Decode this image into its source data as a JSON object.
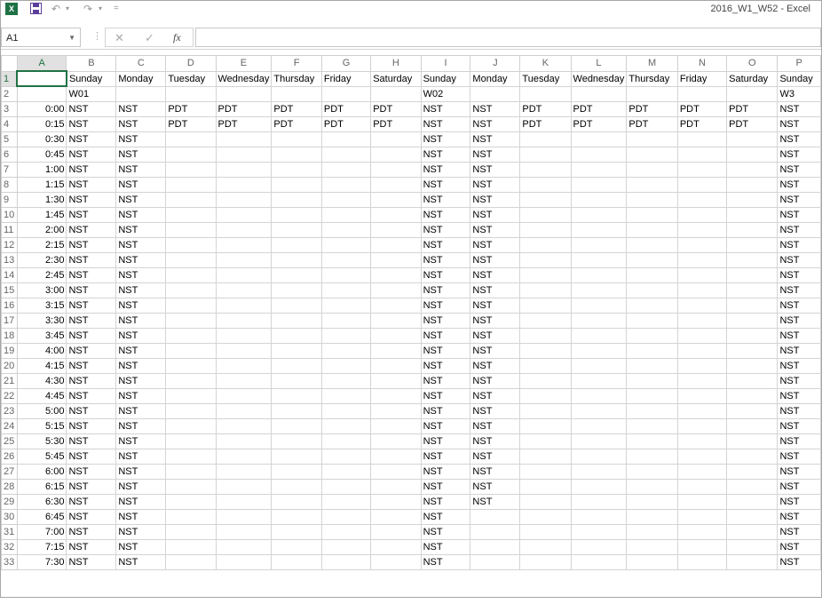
{
  "window": {
    "title": "2016_W1_W52 - Excel"
  },
  "quick_access": {
    "undo": "↶",
    "redo": "↷",
    "customize": "="
  },
  "formula_bar": {
    "name_box": "A1",
    "fx": "fx",
    "cancel": "✕",
    "confirm": "✓",
    "value": ""
  },
  "columns": [
    "A",
    "B",
    "C",
    "D",
    "E",
    "F",
    "G",
    "H",
    "I",
    "J",
    "K",
    "L",
    "M",
    "N",
    "O",
    "P"
  ],
  "rows": [
    {
      "n": "1",
      "cells": [
        "",
        "Sunday",
        "Monday",
        "Tuesday",
        "Wednesday",
        "Thursday",
        "Friday",
        "Saturday",
        "Sunday",
        "Monday",
        "Tuesday",
        "Wednesday",
        "Thursday",
        "Friday",
        "Saturday",
        "Sunday"
      ]
    },
    {
      "n": "2",
      "cells": [
        "",
        "W01",
        "",
        "",
        "",
        "",
        "",
        "",
        "W02",
        "",
        "",
        "",
        "",
        "",
        "",
        "W3"
      ]
    },
    {
      "n": "3",
      "cells": [
        "0:00",
        "NST",
        "NST",
        "PDT",
        "PDT",
        "PDT",
        "PDT",
        "PDT",
        "NST",
        "NST",
        "PDT",
        "PDT",
        "PDT",
        "PDT",
        "PDT",
        "NST"
      ]
    },
    {
      "n": "4",
      "cells": [
        "0:15",
        "NST",
        "NST",
        "PDT",
        "PDT",
        "PDT",
        "PDT",
        "PDT",
        "NST",
        "NST",
        "PDT",
        "PDT",
        "PDT",
        "PDT",
        "PDT",
        "NST"
      ]
    },
    {
      "n": "5",
      "cells": [
        "0:30",
        "NST",
        "NST",
        "",
        "",
        "",
        "",
        "",
        "NST",
        "NST",
        "",
        "",
        "",
        "",
        "",
        "NST"
      ]
    },
    {
      "n": "6",
      "cells": [
        "0:45",
        "NST",
        "NST",
        "",
        "",
        "",
        "",
        "",
        "NST",
        "NST",
        "",
        "",
        "",
        "",
        "",
        "NST"
      ]
    },
    {
      "n": "7",
      "cells": [
        "1:00",
        "NST",
        "NST",
        "",
        "",
        "",
        "",
        "",
        "NST",
        "NST",
        "",
        "",
        "",
        "",
        "",
        "NST"
      ]
    },
    {
      "n": "8",
      "cells": [
        "1:15",
        "NST",
        "NST",
        "",
        "",
        "",
        "",
        "",
        "NST",
        "NST",
        "",
        "",
        "",
        "",
        "",
        "NST"
      ]
    },
    {
      "n": "9",
      "cells": [
        "1:30",
        "NST",
        "NST",
        "",
        "",
        "",
        "",
        "",
        "NST",
        "NST",
        "",
        "",
        "",
        "",
        "",
        "NST"
      ]
    },
    {
      "n": "10",
      "cells": [
        "1:45",
        "NST",
        "NST",
        "",
        "",
        "",
        "",
        "",
        "NST",
        "NST",
        "",
        "",
        "",
        "",
        "",
        "NST"
      ]
    },
    {
      "n": "11",
      "cells": [
        "2:00",
        "NST",
        "NST",
        "",
        "",
        "",
        "",
        "",
        "NST",
        "NST",
        "",
        "",
        "",
        "",
        "",
        "NST"
      ]
    },
    {
      "n": "12",
      "cells": [
        "2:15",
        "NST",
        "NST",
        "",
        "",
        "",
        "",
        "",
        "NST",
        "NST",
        "",
        "",
        "",
        "",
        "",
        "NST"
      ]
    },
    {
      "n": "13",
      "cells": [
        "2:30",
        "NST",
        "NST",
        "",
        "",
        "",
        "",
        "",
        "NST",
        "NST",
        "",
        "",
        "",
        "",
        "",
        "NST"
      ]
    },
    {
      "n": "14",
      "cells": [
        "2:45",
        "NST",
        "NST",
        "",
        "",
        "",
        "",
        "",
        "NST",
        "NST",
        "",
        "",
        "",
        "",
        "",
        "NST"
      ]
    },
    {
      "n": "15",
      "cells": [
        "3:00",
        "NST",
        "NST",
        "",
        "",
        "",
        "",
        "",
        "NST",
        "NST",
        "",
        "",
        "",
        "",
        "",
        "NST"
      ]
    },
    {
      "n": "16",
      "cells": [
        "3:15",
        "NST",
        "NST",
        "",
        "",
        "",
        "",
        "",
        "NST",
        "NST",
        "",
        "",
        "",
        "",
        "",
        "NST"
      ]
    },
    {
      "n": "17",
      "cells": [
        "3:30",
        "NST",
        "NST",
        "",
        "",
        "",
        "",
        "",
        "NST",
        "NST",
        "",
        "",
        "",
        "",
        "",
        "NST"
      ]
    },
    {
      "n": "18",
      "cells": [
        "3:45",
        "NST",
        "NST",
        "",
        "",
        "",
        "",
        "",
        "NST",
        "NST",
        "",
        "",
        "",
        "",
        "",
        "NST"
      ]
    },
    {
      "n": "19",
      "cells": [
        "4:00",
        "NST",
        "NST",
        "",
        "",
        "",
        "",
        "",
        "NST",
        "NST",
        "",
        "",
        "",
        "",
        "",
        "NST"
      ]
    },
    {
      "n": "20",
      "cells": [
        "4:15",
        "NST",
        "NST",
        "",
        "",
        "",
        "",
        "",
        "NST",
        "NST",
        "",
        "",
        "",
        "",
        "",
        "NST"
      ]
    },
    {
      "n": "21",
      "cells": [
        "4:30",
        "NST",
        "NST",
        "",
        "",
        "",
        "",
        "",
        "NST",
        "NST",
        "",
        "",
        "",
        "",
        "",
        "NST"
      ]
    },
    {
      "n": "22",
      "cells": [
        "4:45",
        "NST",
        "NST",
        "",
        "",
        "",
        "",
        "",
        "NST",
        "NST",
        "",
        "",
        "",
        "",
        "",
        "NST"
      ]
    },
    {
      "n": "23",
      "cells": [
        "5:00",
        "NST",
        "NST",
        "",
        "",
        "",
        "",
        "",
        "NST",
        "NST",
        "",
        "",
        "",
        "",
        "",
        "NST"
      ]
    },
    {
      "n": "24",
      "cells": [
        "5:15",
        "NST",
        "NST",
        "",
        "",
        "",
        "",
        "",
        "NST",
        "NST",
        "",
        "",
        "",
        "",
        "",
        "NST"
      ]
    },
    {
      "n": "25",
      "cells": [
        "5:30",
        "NST",
        "NST",
        "",
        "",
        "",
        "",
        "",
        "NST",
        "NST",
        "",
        "",
        "",
        "",
        "",
        "NST"
      ]
    },
    {
      "n": "26",
      "cells": [
        "5:45",
        "NST",
        "NST",
        "",
        "",
        "",
        "",
        "",
        "NST",
        "NST",
        "",
        "",
        "",
        "",
        "",
        "NST"
      ]
    },
    {
      "n": "27",
      "cells": [
        "6:00",
        "NST",
        "NST",
        "",
        "",
        "",
        "",
        "",
        "NST",
        "NST",
        "",
        "",
        "",
        "",
        "",
        "NST"
      ]
    },
    {
      "n": "28",
      "cells": [
        "6:15",
        "NST",
        "NST",
        "",
        "",
        "",
        "",
        "",
        "NST",
        "NST",
        "",
        "",
        "",
        "",
        "",
        "NST"
      ]
    },
    {
      "n": "29",
      "cells": [
        "6:30",
        "NST",
        "NST",
        "",
        "",
        "",
        "",
        "",
        "NST",
        "NST",
        "",
        "",
        "",
        "",
        "",
        "NST"
      ]
    },
    {
      "n": "30",
      "cells": [
        "6:45",
        "NST",
        "NST",
        "",
        "",
        "",
        "",
        "",
        "NST",
        "",
        "",
        "",
        "",
        "",
        "",
        "NST"
      ]
    },
    {
      "n": "31",
      "cells": [
        "7:00",
        "NST",
        "NST",
        "",
        "",
        "",
        "",
        "",
        "NST",
        "",
        "",
        "",
        "",
        "",
        "",
        "NST"
      ]
    },
    {
      "n": "32",
      "cells": [
        "7:15",
        "NST",
        "NST",
        "",
        "",
        "",
        "",
        "",
        "NST",
        "",
        "",
        "",
        "",
        "",
        "",
        "NST"
      ]
    },
    {
      "n": "33",
      "cells": [
        "7:30",
        "NST",
        "NST",
        "",
        "",
        "",
        "",
        "",
        "NST",
        "",
        "",
        "",
        "",
        "",
        "",
        "NST"
      ]
    }
  ]
}
